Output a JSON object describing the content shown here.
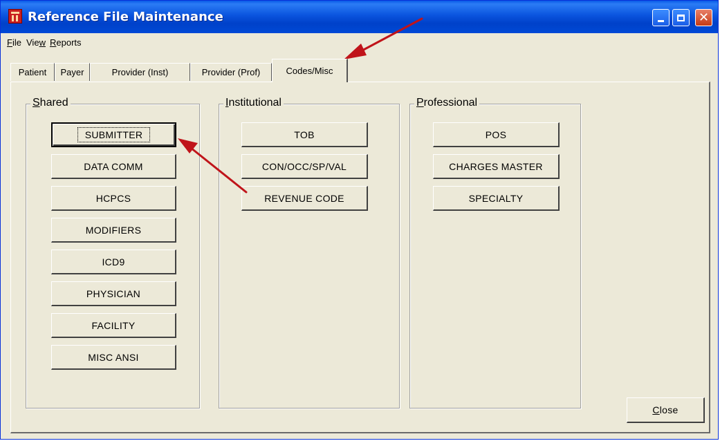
{
  "window": {
    "title": "Reference File Maintenance",
    "icon": "app-icon",
    "controls": {
      "minimize": "minimize-icon",
      "maximize": "maximize-icon",
      "close": "close-icon"
    }
  },
  "menu": {
    "items": [
      {
        "accel": "F",
        "rest": "ile"
      },
      {
        "pre": "Vie",
        "accel": "w",
        "rest": ""
      },
      {
        "accel": "R",
        "rest": "eports"
      }
    ]
  },
  "tabs": [
    "Patient",
    "Payer",
    "Provider (Inst)",
    "Provider (Prof)",
    "Codes/Misc"
  ],
  "active_tab": "Codes/Misc",
  "groups": {
    "shared": {
      "accel": "S",
      "rest": "hared",
      "buttons": [
        "SUBMITTER",
        "DATA COMM",
        "HCPCS",
        "MODIFIERS",
        "ICD9",
        "PHYSICIAN",
        "FACILITY",
        "MISC ANSI"
      ]
    },
    "institutional": {
      "accel": "I",
      "rest": "nstitutional",
      "buttons": [
        "TOB",
        "CON/OCC/SP/VAL",
        "REVENUE CODE"
      ]
    },
    "professional": {
      "accel": "P",
      "rest": "rofessional",
      "buttons": [
        "POS",
        "CHARGES MASTER",
        "SPECIALTY"
      ]
    }
  },
  "close_button": {
    "accel": "C",
    "rest": "lose"
  },
  "colors": {
    "title_bar": "#0a54de",
    "window_bg": "#ece9d8",
    "annotation_arrow": "#c0141a"
  }
}
